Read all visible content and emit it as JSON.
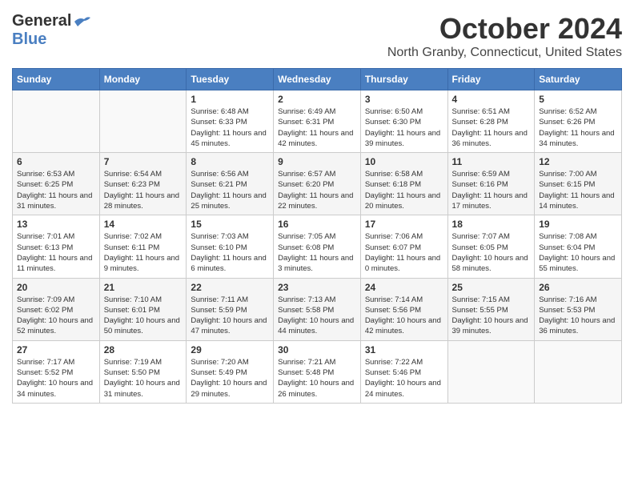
{
  "logo": {
    "part1": "General",
    "part2": "Blue"
  },
  "title": {
    "month_year": "October 2024",
    "location": "North Granby, Connecticut, United States"
  },
  "days_of_week": [
    "Sunday",
    "Monday",
    "Tuesday",
    "Wednesday",
    "Thursday",
    "Friday",
    "Saturday"
  ],
  "weeks": [
    [
      {
        "day": "",
        "info": ""
      },
      {
        "day": "",
        "info": ""
      },
      {
        "day": "1",
        "info": "Sunrise: 6:48 AM\nSunset: 6:33 PM\nDaylight: 11 hours and 45 minutes."
      },
      {
        "day": "2",
        "info": "Sunrise: 6:49 AM\nSunset: 6:31 PM\nDaylight: 11 hours and 42 minutes."
      },
      {
        "day": "3",
        "info": "Sunrise: 6:50 AM\nSunset: 6:30 PM\nDaylight: 11 hours and 39 minutes."
      },
      {
        "day": "4",
        "info": "Sunrise: 6:51 AM\nSunset: 6:28 PM\nDaylight: 11 hours and 36 minutes."
      },
      {
        "day": "5",
        "info": "Sunrise: 6:52 AM\nSunset: 6:26 PM\nDaylight: 11 hours and 34 minutes."
      }
    ],
    [
      {
        "day": "6",
        "info": "Sunrise: 6:53 AM\nSunset: 6:25 PM\nDaylight: 11 hours and 31 minutes."
      },
      {
        "day": "7",
        "info": "Sunrise: 6:54 AM\nSunset: 6:23 PM\nDaylight: 11 hours and 28 minutes."
      },
      {
        "day": "8",
        "info": "Sunrise: 6:56 AM\nSunset: 6:21 PM\nDaylight: 11 hours and 25 minutes."
      },
      {
        "day": "9",
        "info": "Sunrise: 6:57 AM\nSunset: 6:20 PM\nDaylight: 11 hours and 22 minutes."
      },
      {
        "day": "10",
        "info": "Sunrise: 6:58 AM\nSunset: 6:18 PM\nDaylight: 11 hours and 20 minutes."
      },
      {
        "day": "11",
        "info": "Sunrise: 6:59 AM\nSunset: 6:16 PM\nDaylight: 11 hours and 17 minutes."
      },
      {
        "day": "12",
        "info": "Sunrise: 7:00 AM\nSunset: 6:15 PM\nDaylight: 11 hours and 14 minutes."
      }
    ],
    [
      {
        "day": "13",
        "info": "Sunrise: 7:01 AM\nSunset: 6:13 PM\nDaylight: 11 hours and 11 minutes."
      },
      {
        "day": "14",
        "info": "Sunrise: 7:02 AM\nSunset: 6:11 PM\nDaylight: 11 hours and 9 minutes."
      },
      {
        "day": "15",
        "info": "Sunrise: 7:03 AM\nSunset: 6:10 PM\nDaylight: 11 hours and 6 minutes."
      },
      {
        "day": "16",
        "info": "Sunrise: 7:05 AM\nSunset: 6:08 PM\nDaylight: 11 hours and 3 minutes."
      },
      {
        "day": "17",
        "info": "Sunrise: 7:06 AM\nSunset: 6:07 PM\nDaylight: 11 hours and 0 minutes."
      },
      {
        "day": "18",
        "info": "Sunrise: 7:07 AM\nSunset: 6:05 PM\nDaylight: 10 hours and 58 minutes."
      },
      {
        "day": "19",
        "info": "Sunrise: 7:08 AM\nSunset: 6:04 PM\nDaylight: 10 hours and 55 minutes."
      }
    ],
    [
      {
        "day": "20",
        "info": "Sunrise: 7:09 AM\nSunset: 6:02 PM\nDaylight: 10 hours and 52 minutes."
      },
      {
        "day": "21",
        "info": "Sunrise: 7:10 AM\nSunset: 6:01 PM\nDaylight: 10 hours and 50 minutes."
      },
      {
        "day": "22",
        "info": "Sunrise: 7:11 AM\nSunset: 5:59 PM\nDaylight: 10 hours and 47 minutes."
      },
      {
        "day": "23",
        "info": "Sunrise: 7:13 AM\nSunset: 5:58 PM\nDaylight: 10 hours and 44 minutes."
      },
      {
        "day": "24",
        "info": "Sunrise: 7:14 AM\nSunset: 5:56 PM\nDaylight: 10 hours and 42 minutes."
      },
      {
        "day": "25",
        "info": "Sunrise: 7:15 AM\nSunset: 5:55 PM\nDaylight: 10 hours and 39 minutes."
      },
      {
        "day": "26",
        "info": "Sunrise: 7:16 AM\nSunset: 5:53 PM\nDaylight: 10 hours and 36 minutes."
      }
    ],
    [
      {
        "day": "27",
        "info": "Sunrise: 7:17 AM\nSunset: 5:52 PM\nDaylight: 10 hours and 34 minutes."
      },
      {
        "day": "28",
        "info": "Sunrise: 7:19 AM\nSunset: 5:50 PM\nDaylight: 10 hours and 31 minutes."
      },
      {
        "day": "29",
        "info": "Sunrise: 7:20 AM\nSunset: 5:49 PM\nDaylight: 10 hours and 29 minutes."
      },
      {
        "day": "30",
        "info": "Sunrise: 7:21 AM\nSunset: 5:48 PM\nDaylight: 10 hours and 26 minutes."
      },
      {
        "day": "31",
        "info": "Sunrise: 7:22 AM\nSunset: 5:46 PM\nDaylight: 10 hours and 24 minutes."
      },
      {
        "day": "",
        "info": ""
      },
      {
        "day": "",
        "info": ""
      }
    ]
  ]
}
